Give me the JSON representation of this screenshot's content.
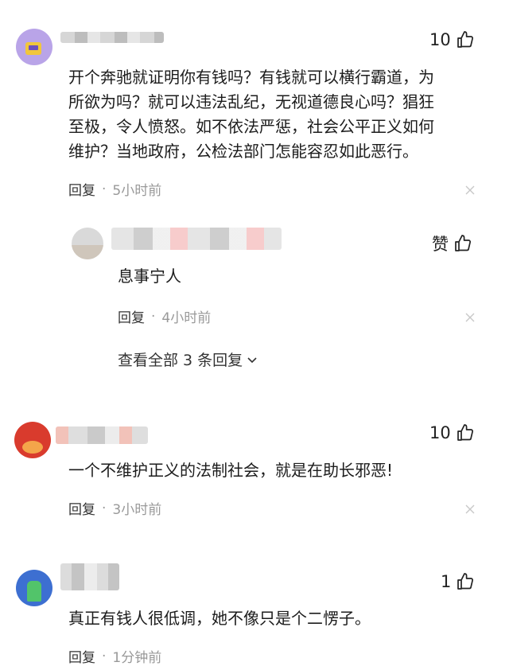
{
  "comments": [
    {
      "likes": "10",
      "text_lines": [
        "开个奔驰就证明你有钱吗？有钱就可以横行霸道，为",
        "所欲为吗？就可以违法乱纪，无视道德良心吗？猖狂",
        "至极，令人愤怒。如不依法严惩，社会公平正义如何",
        "维护？当地政府，公检法部门怎能容忍如此恶行。"
      ],
      "reply_label": "回复",
      "separator": "·",
      "time": "5小时前"
    },
    {
      "likes": "10",
      "text_lines": [
        "一个不维护正义的法制社会，就是在助长邪恶!"
      ],
      "reply_label": "回复",
      "separator": "·",
      "time": "3小时前"
    },
    {
      "likes": "1",
      "text_lines": [
        "真正有钱人很低调，她不像只是个二愣子。"
      ],
      "reply_label": "回复",
      "separator": "·",
      "time": "1分钟前"
    }
  ],
  "sub_reply": {
    "like_label": "赞",
    "text": "息事宁人",
    "reply_label": "回复",
    "separator": "·",
    "time": "4小时前"
  },
  "view_all": "查看全部 3 条回复",
  "icons": {
    "like": "thumbs-up-icon",
    "close": "close-icon",
    "expand": "chevron-down-icon"
  },
  "colors": {
    "text": "#1c1c1c",
    "meta": "#999999"
  }
}
